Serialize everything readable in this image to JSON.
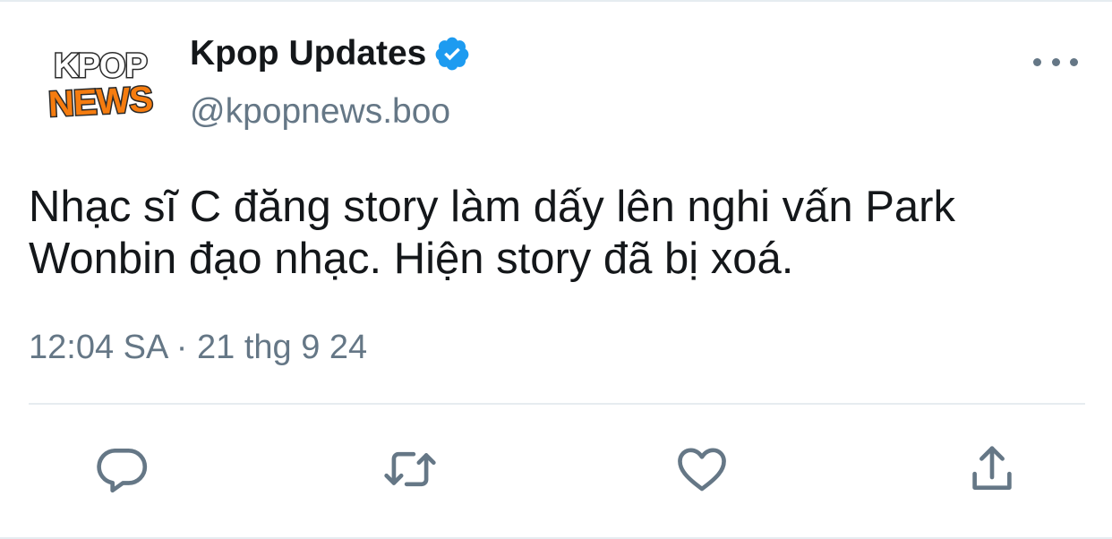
{
  "tweet": {
    "avatar": {
      "line1": "KPOP",
      "line2": "NEWS"
    },
    "display_name": "Kpop Updates",
    "handle": "@kpopnews.boo",
    "verified": true,
    "text": "Nhạc sĩ C đăng story làm dấy lên nghi vấn Park Wonbin đạo nhạc. Hiện story đã bị xoá.",
    "timestamp": "12:04 SA · 21 thg 9 24"
  },
  "actions": {
    "reply_icon": "reply-icon",
    "retweet_icon": "retweet-icon",
    "like_icon": "heart-icon",
    "share_icon": "share-icon"
  },
  "colors": {
    "primary_text": "#14171a",
    "secondary_text": "#657786",
    "verified": "#1d9bf0",
    "avatar_orange": "#f57c0f",
    "divider": "#e6ecf0"
  }
}
